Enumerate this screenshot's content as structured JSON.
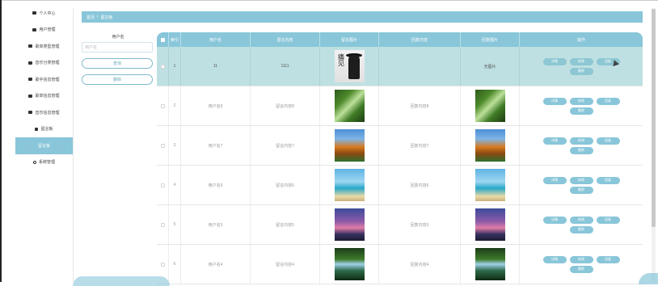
{
  "sidebar": {
    "items": [
      {
        "label": "个人中心",
        "icon": "user-icon"
      },
      {
        "label": "用户管理",
        "icon": "folder-icon"
      },
      {
        "label": "歌单类型管理",
        "icon": "list-icon"
      },
      {
        "label": "音乐分类管理",
        "icon": "message-icon"
      },
      {
        "label": "歌手信息管理",
        "icon": "grid-icon"
      },
      {
        "label": "歌单信息管理",
        "icon": "list-icon"
      },
      {
        "label": "音乐信息管理",
        "icon": "music-icon"
      },
      {
        "label": "留言板",
        "icon": "board-icon"
      },
      {
        "label": "留言板",
        "icon": ""
      },
      {
        "label": "系统管理",
        "icon": "settings-icon"
      }
    ],
    "active_index": 8
  },
  "breadcrumb": {
    "home": "首页",
    "sep": "/",
    "current": "留言板"
  },
  "search": {
    "label": "用户名",
    "placeholder": "用户名",
    "search_button": "查询",
    "delete_button": "删除"
  },
  "table": {
    "headers": [
      "",
      "索引",
      "用户名",
      "留言内容",
      "留言图片",
      "回复内容",
      "回复图片",
      "操作"
    ],
    "rows": [
      {
        "index": "1",
        "user": "11",
        "content": "1111",
        "image": "poster",
        "reply": "",
        "reply_image": "无图片",
        "selected": true
      },
      {
        "index": "2",
        "user": "用户名8",
        "content": "留言内容8",
        "image": "forest",
        "reply": "回复内容8",
        "reply_image": "forest"
      },
      {
        "index": "3",
        "user": "用户名7",
        "content": "留言内容7",
        "image": "autumn",
        "reply": "回复内容7",
        "reply_image": "autumn"
      },
      {
        "index": "4",
        "user": "用户名6",
        "content": "留言内容6",
        "image": "beach",
        "reply": "回复内容6",
        "reply_image": "beach"
      },
      {
        "index": "5",
        "user": "用户名5",
        "content": "留言内容5",
        "image": "dusk",
        "reply": "回复内容5",
        "reply_image": "dusk"
      },
      {
        "index": "6",
        "user": "用户名4",
        "content": "留言内容4",
        "image": "falls",
        "reply": "回复内容4",
        "reply_image": "falls"
      }
    ],
    "actions": [
      "详情",
      "修改",
      "回复",
      "删除"
    ]
  },
  "poster_text": "痛见",
  "colors": {
    "accent": "#89c6d9",
    "selected_row": "#bfe0e2"
  }
}
